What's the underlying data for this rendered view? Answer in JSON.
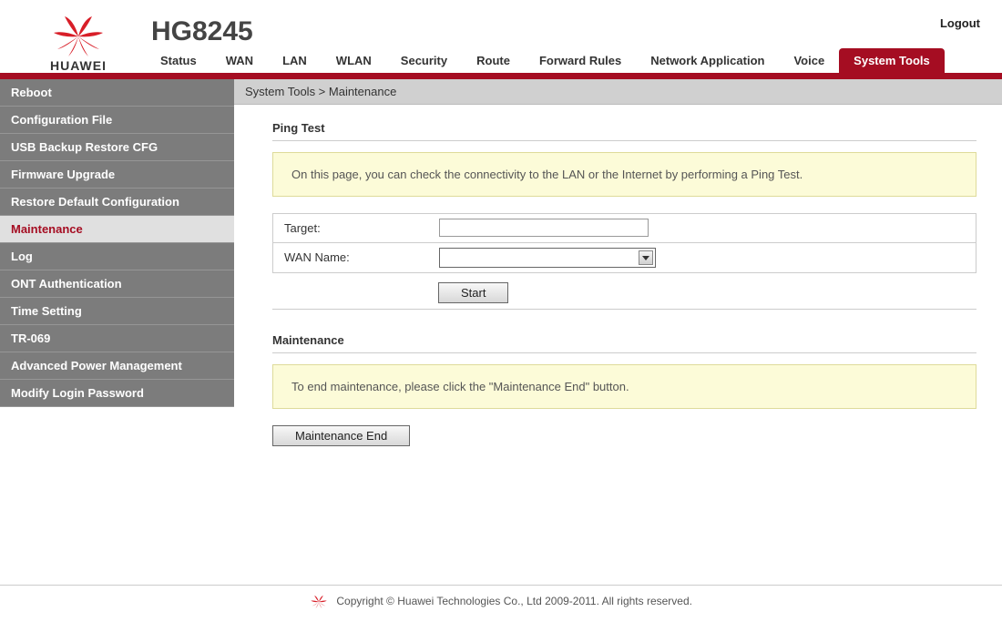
{
  "brand": "HUAWEI",
  "model": "HG8245",
  "logout": "Logout",
  "topnav": {
    "items": [
      {
        "label": "Status"
      },
      {
        "label": "WAN"
      },
      {
        "label": "LAN"
      },
      {
        "label": "WLAN"
      },
      {
        "label": "Security"
      },
      {
        "label": "Route"
      },
      {
        "label": "Forward Rules"
      },
      {
        "label": "Network Application"
      },
      {
        "label": "Voice"
      },
      {
        "label": "System Tools"
      }
    ],
    "active_index": 9
  },
  "sidebar": {
    "items": [
      {
        "label": "Reboot"
      },
      {
        "label": "Configuration File"
      },
      {
        "label": "USB Backup Restore CFG"
      },
      {
        "label": "Firmware Upgrade"
      },
      {
        "label": "Restore Default Configuration"
      },
      {
        "label": "Maintenance"
      },
      {
        "label": "Log"
      },
      {
        "label": "ONT Authentication"
      },
      {
        "label": "Time Setting"
      },
      {
        "label": "TR-069"
      },
      {
        "label": "Advanced Power Management"
      },
      {
        "label": "Modify Login Password"
      }
    ],
    "active_index": 5
  },
  "breadcrumb": "System Tools > Maintenance",
  "ping": {
    "heading": "Ping Test",
    "info": "On this page, you can check the connectivity to the LAN or the Internet by performing a Ping Test.",
    "target_label": "Target:",
    "target_value": "",
    "wan_label": "WAN Name:",
    "wan_value": "",
    "start_label": "Start"
  },
  "maintenance": {
    "heading": "Maintenance",
    "info": "To end maintenance, please click the \"Maintenance End\" button.",
    "end_label": "Maintenance End"
  },
  "footer": {
    "text": "Copyright © Huawei Technologies Co., Ltd 2009-2011. All rights reserved."
  }
}
